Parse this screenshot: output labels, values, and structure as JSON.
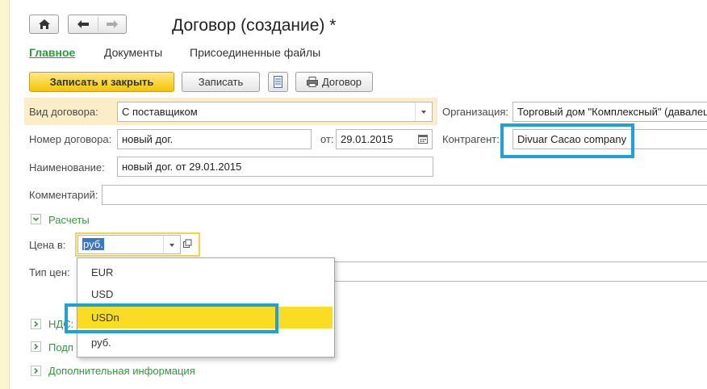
{
  "window": {
    "title": "Договор (создание) *"
  },
  "nav": {
    "home_icon": "home-icon",
    "back_icon": "arrow-left-icon",
    "forward_icon": "arrow-right-icon"
  },
  "tabs": [
    {
      "label": "Главное",
      "active": true
    },
    {
      "label": "Документы",
      "active": false
    },
    {
      "label": "Присоединенные файлы",
      "active": false
    }
  ],
  "toolbar": {
    "save_close_label": "Записать и закрыть",
    "save_label": "Записать",
    "print_label": "Договор"
  },
  "form": {
    "contract_type": {
      "label": "Вид договора:",
      "value": "С поставщиком"
    },
    "organization": {
      "label": "Организация:",
      "value": "Торговый дом \"Комплексный\" (давалец"
    },
    "contract_number": {
      "label": "Номер договора:",
      "value": "новый дог."
    },
    "date": {
      "label": "от:",
      "value": "29.01.2015"
    },
    "counterparty": {
      "label": "Контрагент:",
      "value": "Divuar Cacao company"
    },
    "name": {
      "label": "Наименование:",
      "value": "новый дог. от 29.01.2015"
    },
    "comment": {
      "label": "Комментарий:",
      "value": ""
    }
  },
  "sections": {
    "settlements": "Расчеты",
    "vat": "НДС:",
    "signatories": "Подп",
    "additional": "Дополнительная информация"
  },
  "settlements": {
    "price_in_label": "Цена в:",
    "price_in_value": "руб.",
    "price_type_label": "Тип цен:"
  },
  "currency_dropdown": {
    "options": [
      "EUR",
      "USD",
      "USDn",
      "руб."
    ],
    "highlighted": "USDn"
  },
  "colors": {
    "accent_green": "#2f9a3b",
    "primary_button": "#f5c400",
    "highlight_row": "#fbedc7",
    "annotation_blue": "#1ea0d8",
    "dropdown_highlight": "#fbdc24"
  }
}
